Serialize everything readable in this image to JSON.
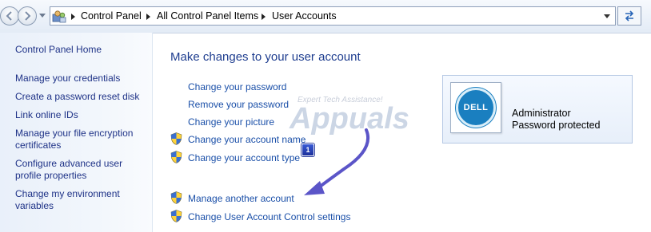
{
  "breadcrumb": [
    "Control Panel",
    "All Control Panel Items",
    "User Accounts"
  ],
  "left_pane": {
    "home": "Control Panel Home",
    "links": [
      "Manage your credentials",
      "Create a password reset disk",
      "Link online IDs",
      "Manage your file encryption certificates",
      "Configure advanced user profile properties",
      "Change my environment variables"
    ]
  },
  "main": {
    "heading": "Make changes to your user account",
    "tasks": [
      {
        "label": "Change your password",
        "shield": false
      },
      {
        "label": "Remove your password",
        "shield": false
      },
      {
        "label": "Change your picture",
        "shield": false
      },
      {
        "label": "Change your account name",
        "shield": true
      },
      {
        "label": "Change your account type",
        "shield": true
      },
      {
        "label": "Manage another account",
        "shield": true
      },
      {
        "label": "Change User Account Control settings",
        "shield": true
      }
    ]
  },
  "account": {
    "name": "Administrator",
    "status": "Password protected",
    "logo_text": "DELL"
  },
  "watermark": {
    "tagline": "Expert Tech Assistance!",
    "name": "Appuals"
  },
  "annotation": {
    "badge": "1"
  },
  "colors": {
    "link": "#1a4fa8",
    "heading": "#1e3d8f",
    "annotation": "#5b55c8"
  },
  "icons": [
    "back-arrow-icon",
    "forward-arrow-icon",
    "control-panel-icon",
    "refresh-icon",
    "uac-shield-icon"
  ]
}
